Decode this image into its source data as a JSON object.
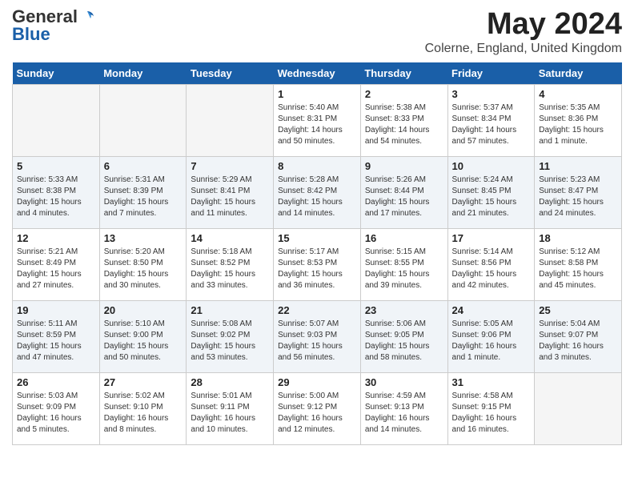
{
  "header": {
    "logo_general": "General",
    "logo_blue": "Blue",
    "month": "May 2024",
    "location": "Colerne, England, United Kingdom"
  },
  "days_of_week": [
    "Sunday",
    "Monday",
    "Tuesday",
    "Wednesday",
    "Thursday",
    "Friday",
    "Saturday"
  ],
  "weeks": [
    [
      {
        "day": "",
        "empty": true
      },
      {
        "day": "",
        "empty": true
      },
      {
        "day": "",
        "empty": true
      },
      {
        "day": "1",
        "sunrise": "5:40 AM",
        "sunset": "8:31 PM",
        "daylight": "14 hours and 50 minutes."
      },
      {
        "day": "2",
        "sunrise": "5:38 AM",
        "sunset": "8:33 PM",
        "daylight": "14 hours and 54 minutes."
      },
      {
        "day": "3",
        "sunrise": "5:37 AM",
        "sunset": "8:34 PM",
        "daylight": "14 hours and 57 minutes."
      },
      {
        "day": "4",
        "sunrise": "5:35 AM",
        "sunset": "8:36 PM",
        "daylight": "15 hours and 1 minute."
      }
    ],
    [
      {
        "day": "5",
        "sunrise": "5:33 AM",
        "sunset": "8:38 PM",
        "daylight": "15 hours and 4 minutes."
      },
      {
        "day": "6",
        "sunrise": "5:31 AM",
        "sunset": "8:39 PM",
        "daylight": "15 hours and 7 minutes."
      },
      {
        "day": "7",
        "sunrise": "5:29 AM",
        "sunset": "8:41 PM",
        "daylight": "15 hours and 11 minutes."
      },
      {
        "day": "8",
        "sunrise": "5:28 AM",
        "sunset": "8:42 PM",
        "daylight": "15 hours and 14 minutes."
      },
      {
        "day": "9",
        "sunrise": "5:26 AM",
        "sunset": "8:44 PM",
        "daylight": "15 hours and 17 minutes."
      },
      {
        "day": "10",
        "sunrise": "5:24 AM",
        "sunset": "8:45 PM",
        "daylight": "15 hours and 21 minutes."
      },
      {
        "day": "11",
        "sunrise": "5:23 AM",
        "sunset": "8:47 PM",
        "daylight": "15 hours and 24 minutes."
      }
    ],
    [
      {
        "day": "12",
        "sunrise": "5:21 AM",
        "sunset": "8:49 PM",
        "daylight": "15 hours and 27 minutes."
      },
      {
        "day": "13",
        "sunrise": "5:20 AM",
        "sunset": "8:50 PM",
        "daylight": "15 hours and 30 minutes."
      },
      {
        "day": "14",
        "sunrise": "5:18 AM",
        "sunset": "8:52 PM",
        "daylight": "15 hours and 33 minutes."
      },
      {
        "day": "15",
        "sunrise": "5:17 AM",
        "sunset": "8:53 PM",
        "daylight": "15 hours and 36 minutes."
      },
      {
        "day": "16",
        "sunrise": "5:15 AM",
        "sunset": "8:55 PM",
        "daylight": "15 hours and 39 minutes."
      },
      {
        "day": "17",
        "sunrise": "5:14 AM",
        "sunset": "8:56 PM",
        "daylight": "15 hours and 42 minutes."
      },
      {
        "day": "18",
        "sunrise": "5:12 AM",
        "sunset": "8:58 PM",
        "daylight": "15 hours and 45 minutes."
      }
    ],
    [
      {
        "day": "19",
        "sunrise": "5:11 AM",
        "sunset": "8:59 PM",
        "daylight": "15 hours and 47 minutes."
      },
      {
        "day": "20",
        "sunrise": "5:10 AM",
        "sunset": "9:00 PM",
        "daylight": "15 hours and 50 minutes."
      },
      {
        "day": "21",
        "sunrise": "5:08 AM",
        "sunset": "9:02 PM",
        "daylight": "15 hours and 53 minutes."
      },
      {
        "day": "22",
        "sunrise": "5:07 AM",
        "sunset": "9:03 PM",
        "daylight": "15 hours and 56 minutes."
      },
      {
        "day": "23",
        "sunrise": "5:06 AM",
        "sunset": "9:05 PM",
        "daylight": "15 hours and 58 minutes."
      },
      {
        "day": "24",
        "sunrise": "5:05 AM",
        "sunset": "9:06 PM",
        "daylight": "16 hours and 1 minute."
      },
      {
        "day": "25",
        "sunrise": "5:04 AM",
        "sunset": "9:07 PM",
        "daylight": "16 hours and 3 minutes."
      }
    ],
    [
      {
        "day": "26",
        "sunrise": "5:03 AM",
        "sunset": "9:09 PM",
        "daylight": "16 hours and 5 minutes."
      },
      {
        "day": "27",
        "sunrise": "5:02 AM",
        "sunset": "9:10 PM",
        "daylight": "16 hours and 8 minutes."
      },
      {
        "day": "28",
        "sunrise": "5:01 AM",
        "sunset": "9:11 PM",
        "daylight": "16 hours and 10 minutes."
      },
      {
        "day": "29",
        "sunrise": "5:00 AM",
        "sunset": "9:12 PM",
        "daylight": "16 hours and 12 minutes."
      },
      {
        "day": "30",
        "sunrise": "4:59 AM",
        "sunset": "9:13 PM",
        "daylight": "16 hours and 14 minutes."
      },
      {
        "day": "31",
        "sunrise": "4:58 AM",
        "sunset": "9:15 PM",
        "daylight": "16 hours and 16 minutes."
      },
      {
        "day": "",
        "empty": true
      }
    ]
  ]
}
